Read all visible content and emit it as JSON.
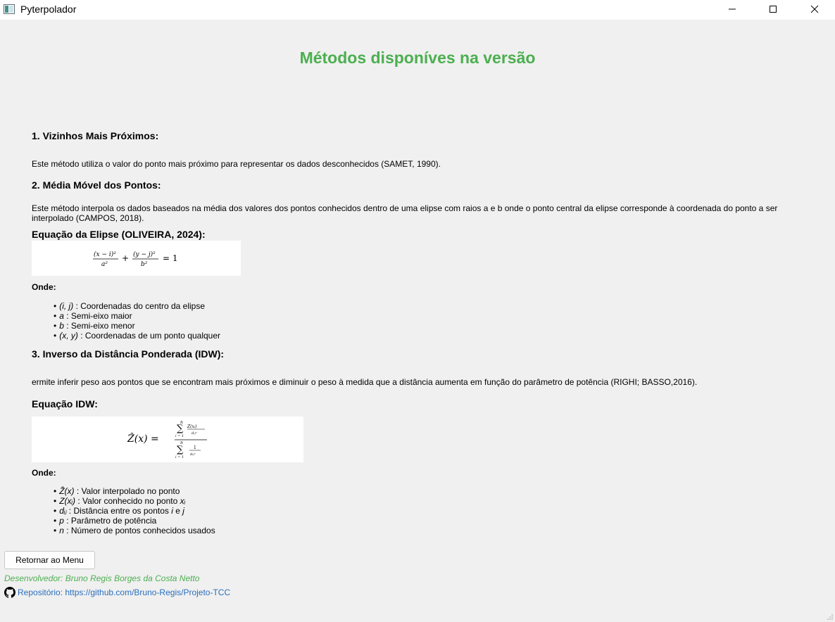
{
  "window": {
    "title": "Pyterpolador",
    "icons": {
      "app": "app-window-icon",
      "minimize": "minimize-icon",
      "maximize": "maximize-icon",
      "close": "close-icon"
    }
  },
  "page": {
    "heading": "Métodos disponíves na versão",
    "heading_color": "#4caf50"
  },
  "section1": {
    "title": "1. Vizinhos Mais Próximos:",
    "text": "Este método utiliza o valor do ponto mais próximo para representar os dados desconhecidos (SAMET, 1990)."
  },
  "section2": {
    "title": "2. Média Móvel dos Pontos:",
    "text": "Este método interpola os dados baseados na média dos valores dos pontos conhecidos dentro de uma elipse com raios a e b onde o ponto central da elipse corresponde à coordenada do ponto a ser interpolado (CAMPOS, 2018).",
    "equation_title": "Equação da Elipse (OLIVEIRA, 2024):",
    "formula": {
      "num1": "(x − i)²",
      "den1": "a²",
      "plus": "+",
      "num2": "(y − j)²",
      "den2": "b²",
      "eq": "= 1"
    },
    "onde": "Onde:",
    "items": [
      {
        "sym": "(i, j)",
        "desc": " : Coordenadas do centro da elipse"
      },
      {
        "sym": "a",
        "desc": " : Semi-eixo maior"
      },
      {
        "sym": "b",
        "desc": " : Semi-eixo menor"
      },
      {
        "sym": "(x, y)",
        "desc": " : Coordenadas de um ponto qualquer"
      }
    ]
  },
  "section3": {
    "title": "3. Inverso da Distância Ponderada (IDW):",
    "text": "ermite inferir peso aos pontos que se encontram mais próximos e diminuir o peso à medida que a distância aumenta em função do parâmetro de potência (RIGHI; BASSO,2016).",
    "equation_title": "Equação IDW:",
    "formula": {
      "lhs": "Ẑ(x) =",
      "sum_top": "n",
      "sum_bottom": "i = 1",
      "num_term": "Z(xᵢ)",
      "num_den": "dᵢⱼᵖ",
      "den_term": "1",
      "den_den": "dᵢⱼᵖ"
    },
    "onde": "Onde:",
    "items": [
      {
        "sym": "Ẑ(x)",
        "desc": " : Valor interpolado no ponto"
      },
      {
        "sym": "Z(xᵢ)",
        "desc": " : Valor conhecido no ponto ",
        "sym2": "xᵢ"
      },
      {
        "sym": "dᵢⱼ",
        "desc": " : Distância entre os pontos ",
        "sym2": "i",
        "mid": " e ",
        "sym3": "j"
      },
      {
        "sym": "p",
        "desc": " : Parâmetro de potência"
      },
      {
        "sym": "n",
        "desc": " : Número de pontos conhecidos usados"
      }
    ]
  },
  "footer": {
    "return_button": "Retornar ao Menu",
    "developer": "Desenvolvedor: Bruno Regis Borges da Costa Netto",
    "repository": "Repositório: https://github.com/Bruno-Regis/Projeto-TCC",
    "developer_color": "#4caf50",
    "link_color": "#2a6ebd",
    "repo_icon": "github-icon"
  }
}
